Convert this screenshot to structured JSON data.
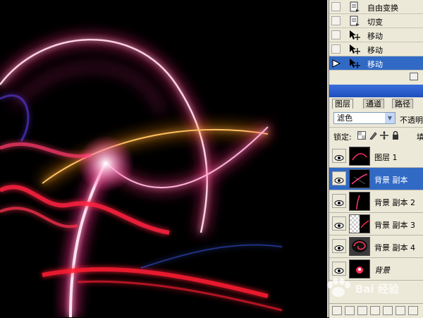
{
  "history": {
    "items": [
      {
        "label": "自由变换",
        "icon": "transform-doc-icon",
        "active": false
      },
      {
        "label": "切变",
        "icon": "transform-doc-icon",
        "active": false
      },
      {
        "label": "移动",
        "icon": "move-tool-icon",
        "active": false
      },
      {
        "label": "移动",
        "icon": "move-tool-icon",
        "active": false
      },
      {
        "label": "移动",
        "icon": "move-tool-icon",
        "active": true
      }
    ]
  },
  "layers_panel": {
    "tabs": [
      {
        "label": "图层",
        "active": true
      },
      {
        "label": "通道",
        "active": false
      },
      {
        "label": "路径",
        "active": false
      }
    ],
    "blend_mode": "滤色",
    "opacity_label": "不透明",
    "lock_label": "锁定:",
    "fill_label": "填",
    "layers": [
      {
        "name": "图层 1",
        "visible": true,
        "active": false,
        "italic": false
      },
      {
        "name": "背景 副本",
        "visible": true,
        "active": true,
        "italic": false
      },
      {
        "name": "背景 副本 2",
        "visible": true,
        "active": false,
        "italic": false
      },
      {
        "name": "背景 副本 3",
        "visible": true,
        "active": false,
        "italic": false
      },
      {
        "name": "背景 副本 4",
        "visible": true,
        "active": false,
        "italic": false
      },
      {
        "name": "背景",
        "visible": true,
        "active": false,
        "italic": true
      }
    ]
  },
  "watermark": {
    "text": "Bai 经验"
  },
  "colors": {
    "selection": "#316ac5",
    "panel_bg": "#ece9d8",
    "glow_pink": "#ff2a8a",
    "glow_red": "#ff1a30",
    "glow_orange": "#ff9a20"
  }
}
